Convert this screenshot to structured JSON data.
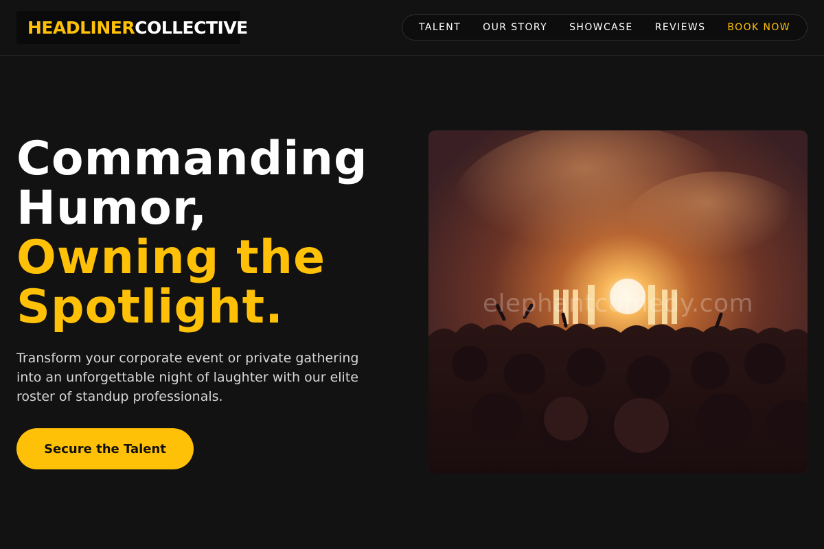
{
  "header": {
    "logo_part1": "HEADLINER",
    "logo_part2": "COLLECTIVE",
    "nav": [
      {
        "label": "TALENT"
      },
      {
        "label": "OUR STORY"
      },
      {
        "label": "SHOWCASE"
      },
      {
        "label": "REVIEWS"
      },
      {
        "label": "BOOK NOW"
      }
    ]
  },
  "hero": {
    "headline_line1": "Commanding",
    "headline_line2": "Humor,",
    "headline_accent1": "Owning the",
    "headline_accent2": "Spotlight.",
    "lead": "Transform your corporate event or private gathering into an unforgettable night of laughter with our elite roster of standup professionals.",
    "cta_label": "Secure the Talent",
    "image_watermark": "elephantcomedy.com"
  },
  "colors": {
    "background": "#121212",
    "accent": "#ffc107",
    "text": "#ffffff"
  }
}
